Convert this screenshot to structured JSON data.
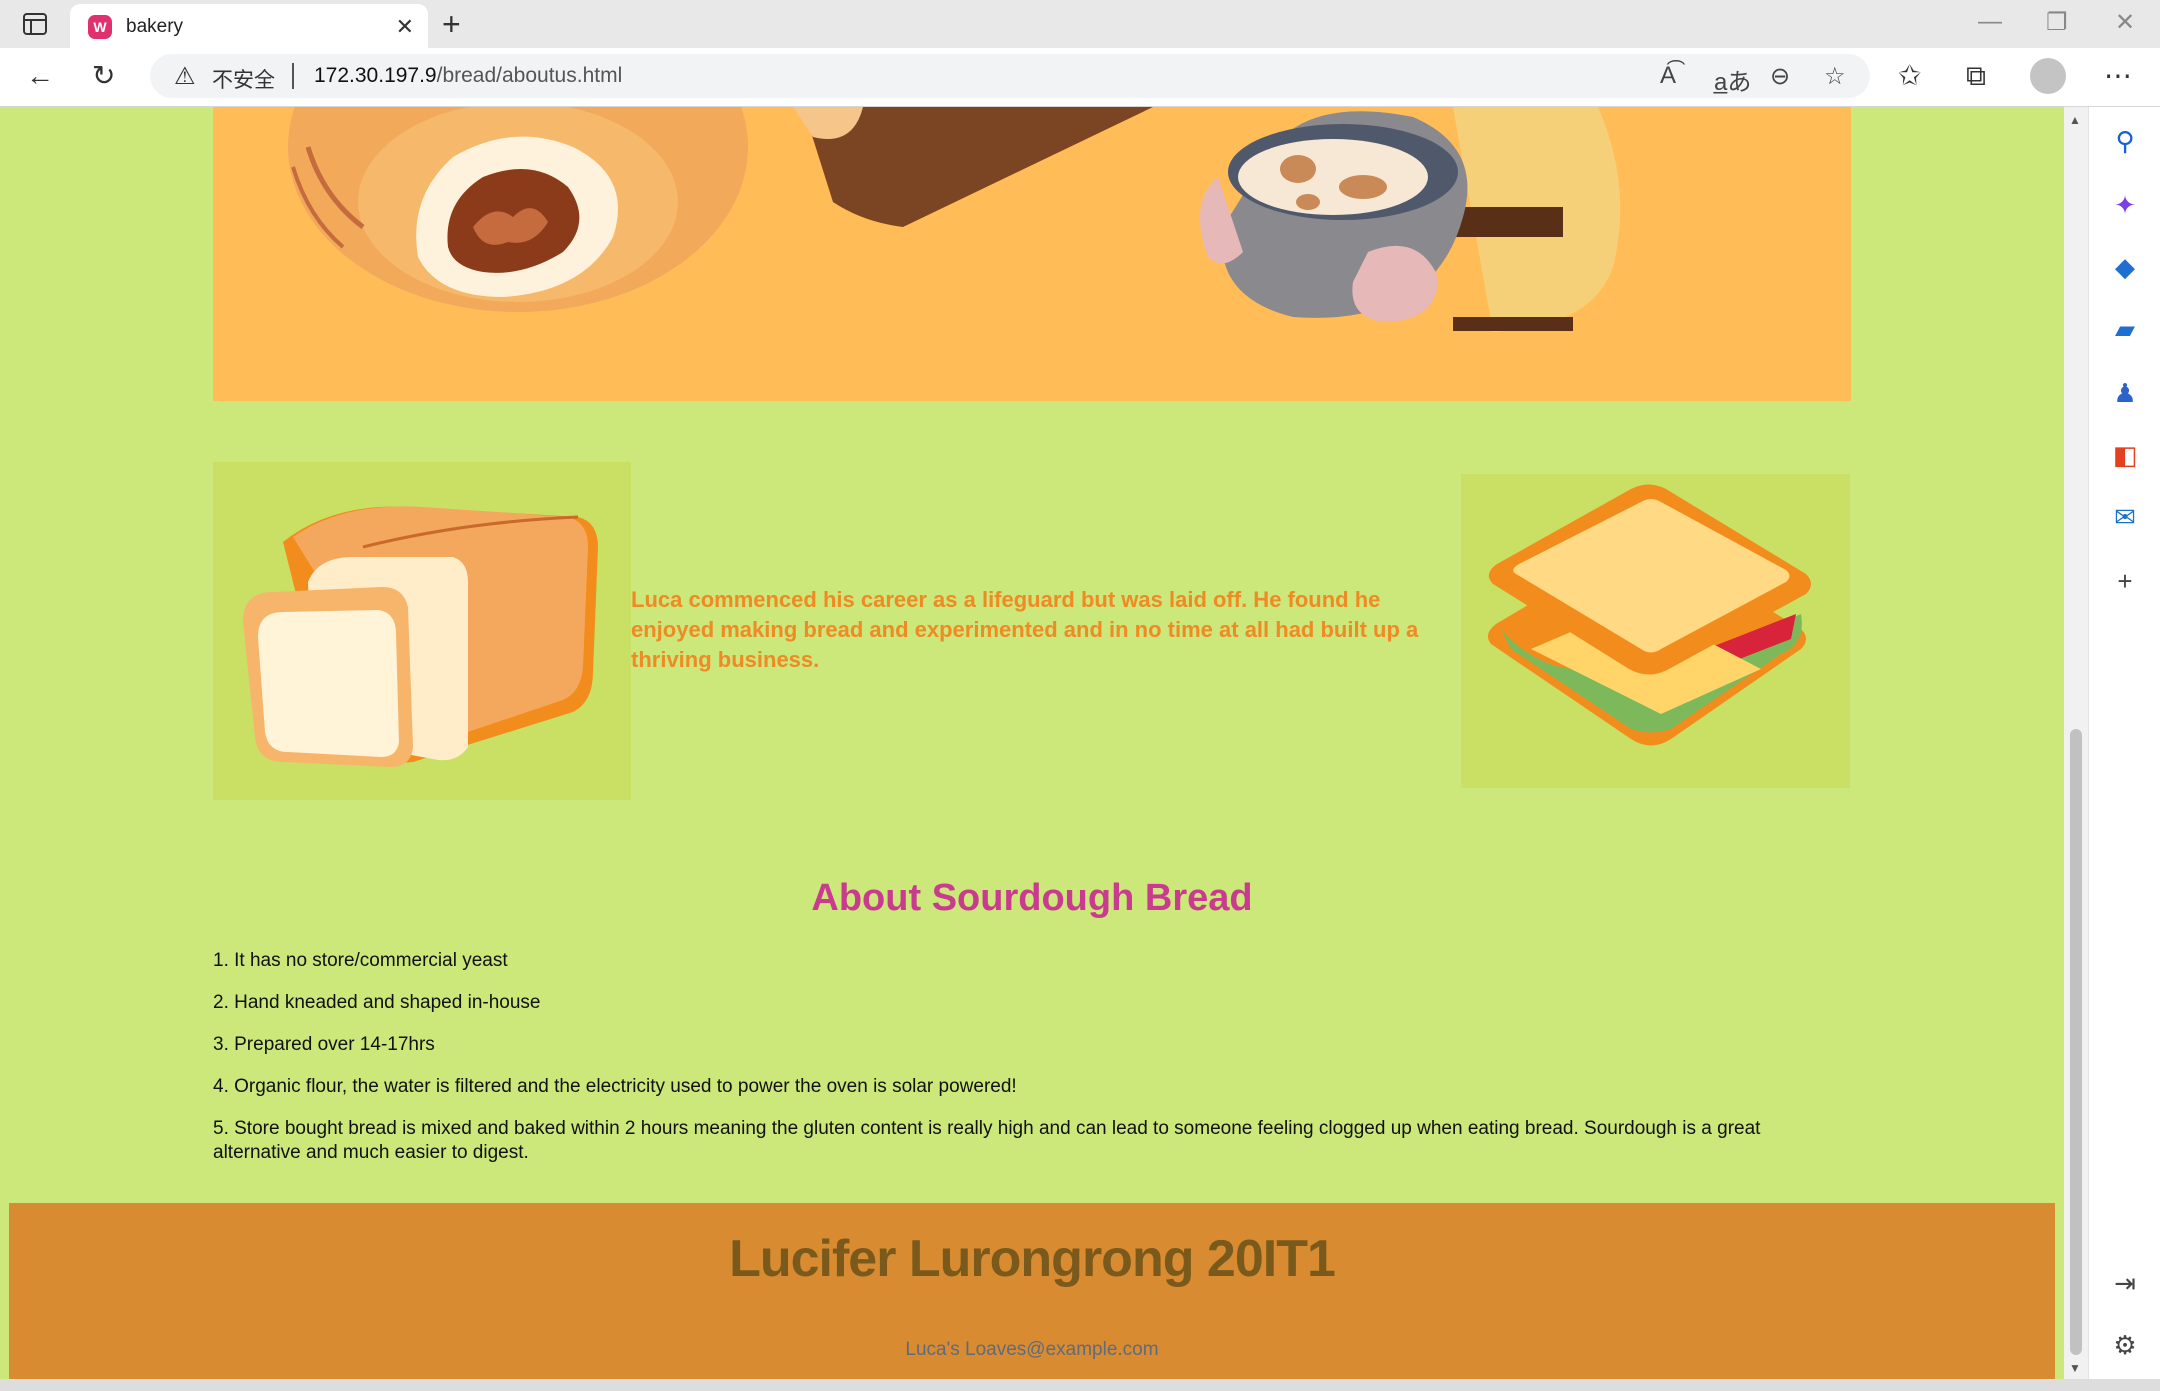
{
  "browser": {
    "tab_title": "bakery",
    "tab_favicon_letter": "W",
    "security_label": "不安全",
    "url_host": "172.30.197.9",
    "url_path": "/bread/aboutus.html"
  },
  "intro": {
    "text": "Luca commenced his career as a lifeguard but was laid off. He found he enjoyed making bread and experimented and in no time at all had built up a thriving business."
  },
  "about": {
    "heading": "About Sourdough Bread",
    "facts": [
      "1. It has no store/commercial yeast",
      "2. Hand kneaded and shaped in-house",
      "3. Prepared over 14-17hrs",
      "4. Organic flour, the water is filtered and the electricity used to power the oven is solar powered!",
      "5. Store bought bread is mixed and baked within 2 hours meaning the gluten content is really high and can lead to someone feeling clogged up when eating bread. Sourdough is a great alternative and much easier to digest."
    ]
  },
  "footer": {
    "name": "Lucifer Lurongrong 20IT1",
    "email": "Luca's Loaves@example.com"
  },
  "colors": {
    "page_bg": "#cce77a",
    "banner_bg": "#ffbc57",
    "intro_text": "#f08a24",
    "heading": "#c93b8f",
    "footer_bg": "#d98b31",
    "footer_name": "#7a5a1c"
  },
  "icons": {
    "sidebar": [
      "search-icon",
      "copilot-icon",
      "shopping-tag-icon",
      "toolbox-icon",
      "games-icon",
      "office-icon",
      "outlook-icon",
      "add-icon"
    ],
    "sidebar_bottom": [
      "panel-toggle-icon",
      "settings-icon"
    ]
  }
}
